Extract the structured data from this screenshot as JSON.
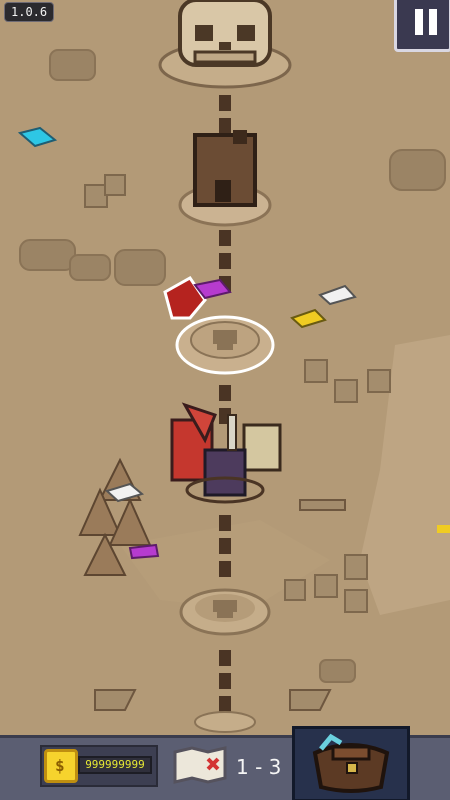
{
  "hud": {
    "version": "1.0.6",
    "coins": "999999999",
    "level": "1 - 3"
  },
  "icons": {
    "pause": "pause-icon",
    "coin": "coin-icon",
    "map": "treasure-map-icon",
    "bag": "inventory-bag-icon"
  },
  "colors": {
    "ground": "#b39a77",
    "path": "#4a3424",
    "node_selected": "#ffffff",
    "hud_bar": "#5b5e72",
    "coin": "#f6d32d"
  }
}
